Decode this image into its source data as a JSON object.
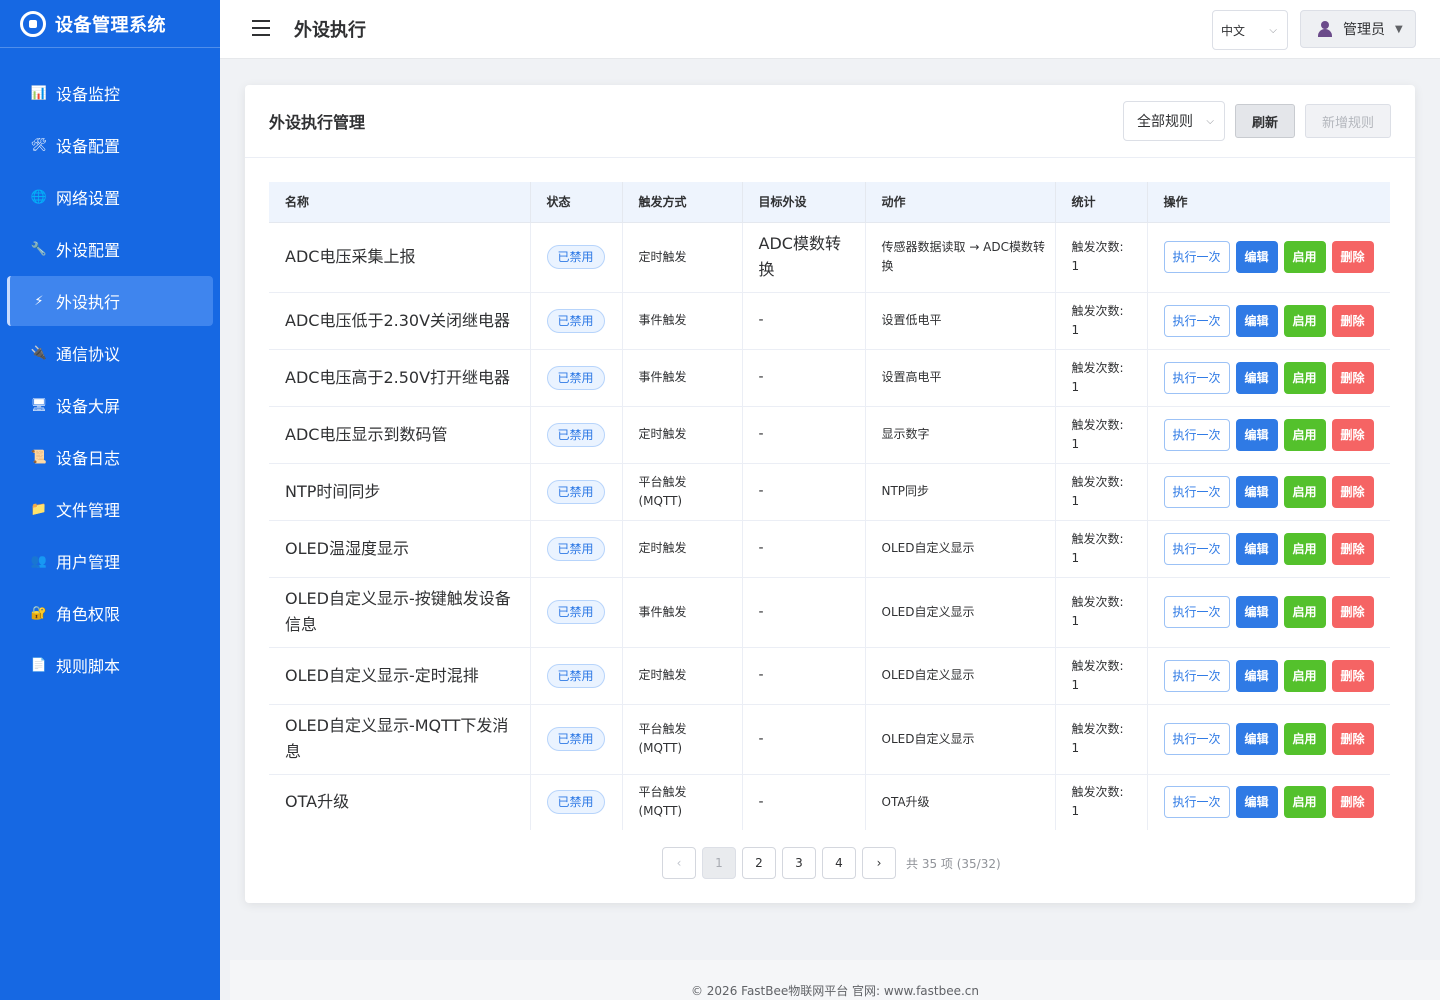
{
  "brand": {
    "title": "设备管理系统"
  },
  "sidebar": {
    "items": [
      {
        "label": "设备监控",
        "icon": "chart-icon"
      },
      {
        "label": "设备配置",
        "icon": "tools-icon"
      },
      {
        "label": "网络设置",
        "icon": "globe-icon"
      },
      {
        "label": "外设配置",
        "icon": "wrench-icon"
      },
      {
        "label": "外设执行",
        "icon": "bolt-icon",
        "active": true
      },
      {
        "label": "通信协议",
        "icon": "plug-icon"
      },
      {
        "label": "设备大屏",
        "icon": "monitor-icon"
      },
      {
        "label": "设备日志",
        "icon": "scroll-icon"
      },
      {
        "label": "文件管理",
        "icon": "folder-icon"
      },
      {
        "label": "用户管理",
        "icon": "users-icon"
      },
      {
        "label": "角色权限",
        "icon": "lock-icon"
      },
      {
        "label": "规则脚本",
        "icon": "script-icon"
      }
    ]
  },
  "header": {
    "title": "外设执行",
    "language": "中文",
    "user": "管理员"
  },
  "card": {
    "title": "外设执行管理",
    "filter": "全部规则",
    "refresh_label": "刷新",
    "add_label": "新增规则"
  },
  "table": {
    "columns": [
      "名称",
      "状态",
      "触发方式",
      "目标外设",
      "动作",
      "统计",
      "操作"
    ],
    "ops": {
      "exec": "执行一次",
      "edit": "编辑",
      "enable": "启用",
      "delete": "删除"
    },
    "stat_label": "触发次数:",
    "rows": [
      {
        "name": "ADC电压采集上报",
        "status": "已禁用",
        "trigger": "定时触发",
        "target": "ADC模数转换",
        "action": "传感器数据读取 → ADC模数转换",
        "count": "1"
      },
      {
        "name": "ADC电压低于2.30V关闭继电器",
        "status": "已禁用",
        "trigger": "事件触发",
        "target": "-",
        "action": "设置低电平",
        "count": "1"
      },
      {
        "name": "ADC电压高于2.50V打开继电器",
        "status": "已禁用",
        "trigger": "事件触发",
        "target": "-",
        "action": "设置高电平",
        "count": "1"
      },
      {
        "name": "ADC电压显示到数码管",
        "status": "已禁用",
        "trigger": "定时触发",
        "target": "-",
        "action": "显示数字",
        "count": "1"
      },
      {
        "name": "NTP时间同步",
        "status": "已禁用",
        "trigger": "平台触发(MQTT)",
        "target": "-",
        "action": "NTP同步",
        "count": "1"
      },
      {
        "name": "OLED温湿度显示",
        "status": "已禁用",
        "trigger": "定时触发",
        "target": "-",
        "action": "OLED自定义显示",
        "count": "1"
      },
      {
        "name": "OLED自定义显示-按键触发设备信息",
        "status": "已禁用",
        "trigger": "事件触发",
        "target": "-",
        "action": "OLED自定义显示",
        "count": "1"
      },
      {
        "name": "OLED自定义显示-定时混排",
        "status": "已禁用",
        "trigger": "定时触发",
        "target": "-",
        "action": "OLED自定义显示",
        "count": "1"
      },
      {
        "name": "OLED自定义显示-MQTT下发消息",
        "status": "已禁用",
        "trigger": "平台触发(MQTT)",
        "target": "-",
        "action": "OLED自定义显示",
        "count": "1"
      },
      {
        "name": "OTA升级",
        "status": "已禁用",
        "trigger": "平台触发(MQTT)",
        "target": "-",
        "action": "OTA升级",
        "count": "1"
      }
    ]
  },
  "pagination": {
    "prev": "‹",
    "next": "›",
    "pages": [
      "1",
      "2",
      "3",
      "4"
    ],
    "current": "1",
    "total_text": "共 35 项 (35/32)"
  },
  "footer": {
    "text": "© 2026 FastBee物联网平台 官网: www.fastbee.cn"
  },
  "colors": {
    "sidebar": "#1668e3",
    "primary": "#2f7ae5",
    "success": "#54c12c",
    "danger": "#f56464"
  }
}
